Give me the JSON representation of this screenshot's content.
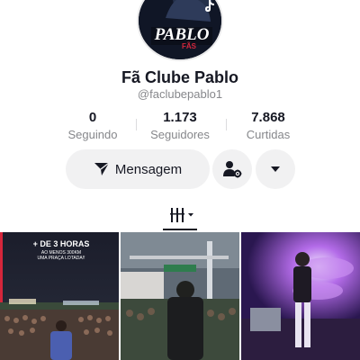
{
  "profile": {
    "display_name": "Fã Clube Pablo",
    "username": "@faclubepablo1",
    "avatar_text": "PABLO",
    "avatar_subtext": "FÃS"
  },
  "stats": [
    {
      "value": "0",
      "label": "Seguindo"
    },
    {
      "value": "1.173",
      "label": "Seguidores"
    },
    {
      "value": "7.868",
      "label": "Curtidas"
    }
  ],
  "actions": {
    "message_label": "Mensagem",
    "friend_icon": "add-friend-settings-icon",
    "more_icon": "caret-down-icon"
  },
  "tabs": {
    "active_icon": "videos-grid-icon"
  },
  "videos": [
    {
      "caption_lines": [
        "+ DE 3 HORAS",
        "AO MENOS 300KM",
        "UMA PRAÇA LOTADA!!"
      ]
    },
    {
      "caption_lines": []
    },
    {
      "caption_lines": []
    }
  ],
  "colors": {
    "text": "#161823",
    "muted": "#86878b",
    "button_bg": "#f1f1f2",
    "avatar_accent": "#d5263b"
  }
}
